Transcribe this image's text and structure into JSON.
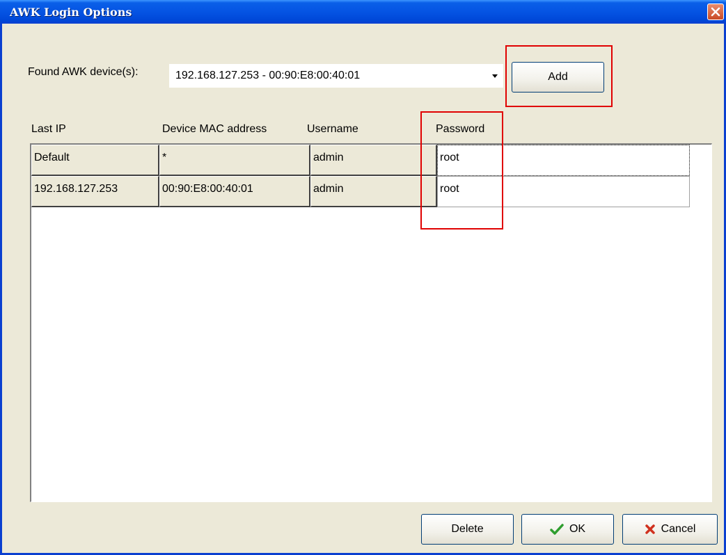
{
  "window": {
    "title": "AWK Login Options"
  },
  "found": {
    "label": "Found AWK device(s):",
    "selected": "192.168.127.253 - 00:90:E8:00:40:01"
  },
  "buttons": {
    "add": "Add",
    "delete": "Delete",
    "ok": "OK",
    "cancel": "Cancel"
  },
  "table": {
    "headers": [
      "Last IP",
      "Device MAC address",
      "Username",
      "Password"
    ],
    "rows": [
      [
        "Default",
        "*",
        "admin",
        "root"
      ],
      [
        "192.168.127.253",
        "00:90:E8:00:40:01",
        "admin",
        "root"
      ]
    ]
  },
  "colors": {
    "title_bar": "#0554e3",
    "highlight": "#e00000",
    "ok_check": "#2f9e2f",
    "cancel_x": "#d0311e"
  },
  "icons": {
    "close": "close-icon",
    "dropdown": "chevron-down-icon",
    "ok": "checkmark-icon",
    "cancel": "x-icon"
  }
}
